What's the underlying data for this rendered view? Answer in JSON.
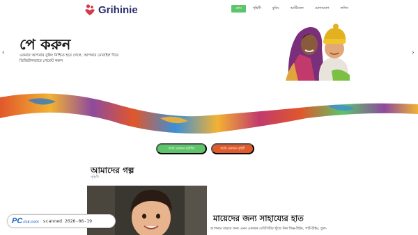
{
  "header": {
    "logo_text": "Grihinie",
    "nav": [
      {
        "label": "হোম",
        "active": true
      },
      {
        "label": "গৃহিণী",
        "active": false
      },
      {
        "label": "বুকিং",
        "active": false
      },
      {
        "label": "আর্টিকেল",
        "active": false
      },
      {
        "label": "যোগাযোগ",
        "active": false
      },
      {
        "label": "লগিন",
        "active": false
      }
    ]
  },
  "hero": {
    "title": "পে করুন",
    "description": "একবার আপনার বুকিং নিশ্চিত হয়ে গেলে, আপনার মোবাইল দিয়ে ডিজিটালভাবে পেমেন্ট করুন",
    "prev_arrow": "‹",
    "next_arrow": "›"
  },
  "buttons": {
    "primary": "আমি একজন গৃহিণীর",
    "secondary": "আমি একজন গৃহিণী"
  },
  "story": {
    "heading": "আমাদের গল্প",
    "subheading": "গৃহিণী",
    "help_title": "মায়েদের জন্য সাহায্যের হাত",
    "help_desc": "আপনার বাচ্চার জন্য এমন একজন বেবিসিটার খুঁজে নিন ফিক্স-টাইম, পার্ট-টাইম, ফুল-"
  },
  "watermark": {
    "logo_pc": "PC",
    "logo_risk": "risk.com",
    "scanned": "scanned 2026-06-19"
  },
  "colors": {
    "brand_green": "#5cc469",
    "brand_orange": "#e05a2a",
    "logo_navy": "#2b2d6e",
    "logo_red": "#d23b4a"
  }
}
